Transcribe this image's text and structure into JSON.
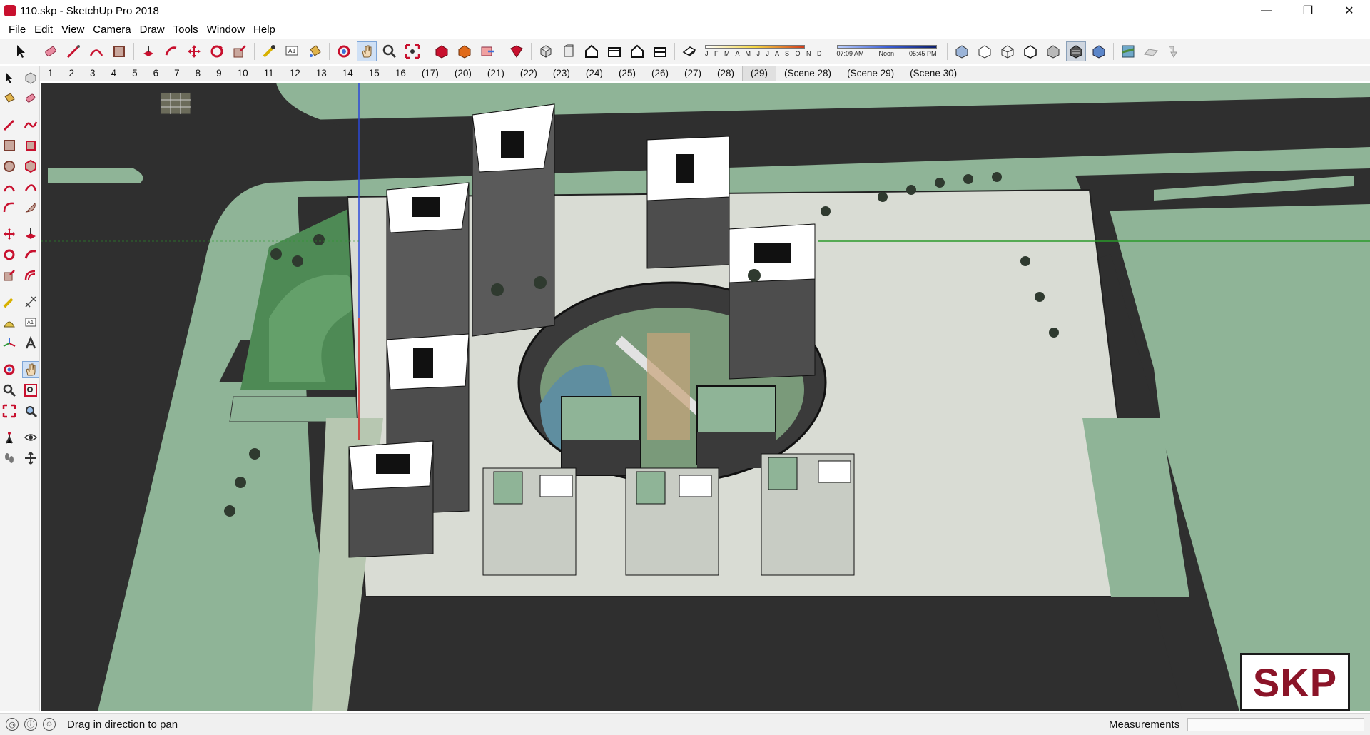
{
  "window": {
    "title": "110.skp - SketchUp Pro 2018",
    "minimize_icon": "minimize-icon",
    "restore_icon": "restore-icon",
    "close_icon": "close-icon",
    "minimize_glyph": "—",
    "restore_glyph": "❐",
    "close_glyph": "✕"
  },
  "menu": [
    "File",
    "Edit",
    "View",
    "Camera",
    "Draw",
    "Tools",
    "Window",
    "Help"
  ],
  "shadows": {
    "months": "J F M A M J J A S O N D",
    "time_start": "07:09 AM",
    "time_mid": "Noon",
    "time_end": "05:45 PM"
  },
  "scenes": [
    "1",
    "2",
    "3",
    "4",
    "5",
    "6",
    "7",
    "8",
    "9",
    "10",
    "11",
    "12",
    "13",
    "14",
    "15",
    "16",
    "(17)",
    "(20)",
    "(21)",
    "(22)",
    "(23)",
    "(24)",
    "(25)",
    "(26)",
    "(27)",
    "(28)",
    "(29)",
    "(Scene 28)",
    "(Scene 29)",
    "(Scene 30)"
  ],
  "active_scene": "(29)",
  "status": {
    "message": "Drag in direction to pan",
    "measurements_label": "Measurements",
    "measurements_value": ""
  },
  "badge": {
    "text": "SKP"
  },
  "colors": {
    "grass": "#8fb497",
    "road": "#2f2f2f",
    "plaza": "#d9dcd4",
    "roof": "#ffffff",
    "accent_red": "#c8102e",
    "badge_text": "#8b1428"
  }
}
